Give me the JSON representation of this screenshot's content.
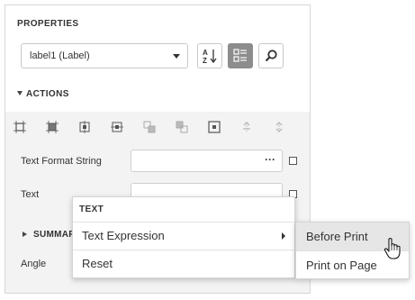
{
  "panel": {
    "title": "PROPERTIES",
    "selector_value": "label1 (Label)",
    "toolbar": {
      "sort_icon": "sort-alphabetical-icon",
      "categories_icon": "categorized-list-icon",
      "search_icon": "search-icon"
    }
  },
  "actions": {
    "title": "ACTIONS",
    "icons": [
      "align-to-grid-icon",
      "size-to-grid-icon",
      "center-horizontally-icon",
      "center-vertically-icon",
      "bring-to-front-icon",
      "send-to-back-icon",
      "anchor-center-icon",
      "align-top-icon",
      "align-bottom-icon"
    ]
  },
  "properties": [
    {
      "label": "Text Format String",
      "value": "",
      "button": "···"
    },
    {
      "label": "Text",
      "value": ""
    },
    {
      "label": "Angle",
      "value": ""
    }
  ],
  "summary": {
    "title": "SUMMAR"
  },
  "context_menu": {
    "header": "TEXT",
    "items": [
      {
        "label": "Text Expression",
        "has_submenu": true
      },
      {
        "label": "Reset"
      }
    ]
  },
  "submenu": {
    "items": [
      {
        "label": "Before Print",
        "hovered": true
      },
      {
        "label": "Print on Page"
      }
    ]
  },
  "colors": {
    "panel_bg": "#f3f3f3",
    "active_button": "#8c8c8c",
    "hover_bg": "#e6e6e6"
  }
}
